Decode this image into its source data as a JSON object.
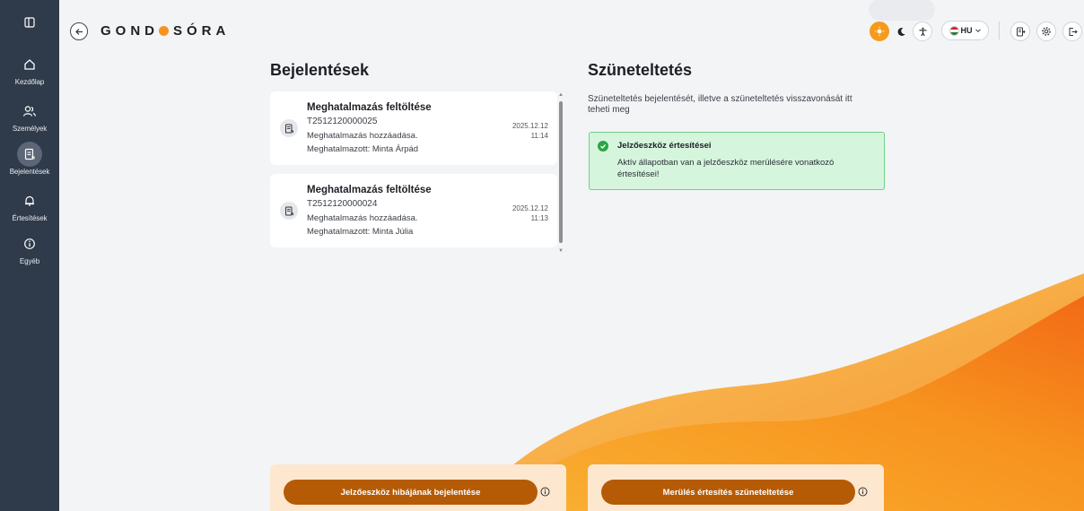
{
  "app": {
    "logo_part1": "GOND",
    "logo_part2": "SÓRA"
  },
  "sidebar": {
    "items": [
      {
        "label": "Kezdőlap",
        "icon": "home-icon"
      },
      {
        "label": "Személyek",
        "icon": "users-icon"
      },
      {
        "label": "Bejelentések",
        "icon": "document-icon",
        "active": true
      },
      {
        "label": "Értesítések",
        "icon": "bell-icon"
      },
      {
        "label": "Egyéb",
        "icon": "info-icon"
      }
    ]
  },
  "topbar": {
    "language": "HU"
  },
  "left": {
    "heading": "Bejelentések",
    "cards": [
      {
        "title": "Meghatalmazás feltöltése",
        "id": "T2512120000025",
        "line1": "Meghatalmazás hozzáadása.",
        "line2": "Meghatalmazott: Minta Árpád",
        "date": "2025.12.12",
        "time": "11:14"
      },
      {
        "title": "Meghatalmazás feltöltése",
        "id": "T2512120000024",
        "line1": "Meghatalmazás hozzáadása.",
        "line2": "Meghatalmazott: Minta Júlia",
        "date": "2025.12.12",
        "time": "11:13"
      }
    ],
    "action_button": "Jelzőeszköz hibájának bejelentése"
  },
  "right": {
    "heading": "Szüneteltetés",
    "description": "Szüneteltetés bejelentését, illetve a szüneteltetés visszavonását itt teheti meg",
    "alert": {
      "title": "Jelzőeszköz értesítései",
      "text": "Aktív állapotban van a jelzőeszköz merülésére vonatkozó értesítései!"
    },
    "action_button": "Merülés értesítés szüneteltetése"
  },
  "colors": {
    "sidebar": "#2f3a4a",
    "accent": "#f7931e",
    "button": "#b65b05",
    "alert_bg": "#d6f5dd",
    "alert_border": "#6fd08a"
  }
}
